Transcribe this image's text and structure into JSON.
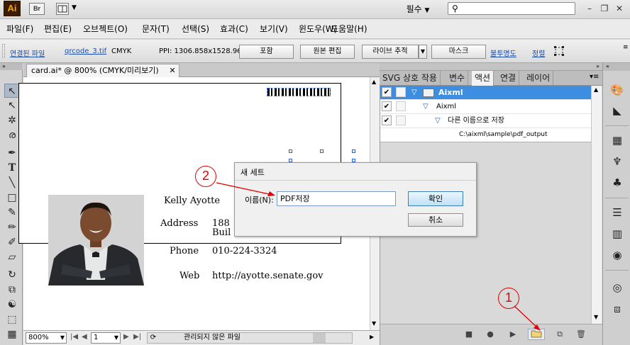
{
  "app": {
    "logo": "Ai",
    "bridge_label": "Br",
    "workspace": "필수",
    "search_placeholder": ""
  },
  "colors": {
    "accent_callout": "#e00000",
    "selection_blue": "#3d8ee0",
    "link_blue": "#1a4ea8"
  },
  "menu": [
    "파일(F)",
    "편집(E)",
    "오브젝트(O)",
    "문자(T)",
    "선택(S)",
    "효과(C)",
    "보기(V)",
    "윈도우(W)",
    "도움말(H)"
  ],
  "control": {
    "linked_file": "연결된 파일",
    "filename": "qrcode_3.tif",
    "colormode": "CMYK",
    "ppi": "PPI: 1306.858x1528.966",
    "embed": "포함",
    "edit_original": "원본 편집",
    "live_trace": "라이브 추적",
    "mask": "마스크",
    "opacity": "불투명도",
    "align": "정렬"
  },
  "document": {
    "tab_title": "card.ai* @ 800% (CMYK/미리보기)",
    "zoom": "800%",
    "page": "1",
    "status": "관리되지 않은 파일"
  },
  "card": {
    "name": "Kelly Ayotte",
    "address_label": "Address",
    "address_line1": "188",
    "address_line2": "Buil",
    "phone_label": "Phone",
    "phone": "010-224-3324",
    "web_label": "Web",
    "web": "http://ayotte.senate.gov"
  },
  "panel": {
    "tabs": [
      "SVG 상호 작용",
      "변수",
      "액션",
      "연결",
      "레이어"
    ],
    "active_tab": 2,
    "actions": [
      {
        "label": "Aixml",
        "level": 0,
        "checked": true,
        "selected": true,
        "type": "folder"
      },
      {
        "label": "Aixml",
        "level": 1,
        "checked": true,
        "selected": false,
        "type": "action"
      },
      {
        "label": "다른 이름으로 저장",
        "level": 2,
        "checked": true,
        "selected": false,
        "type": "command"
      },
      {
        "label": "C:\\aixml\\sample\\pdf_output",
        "level": 3,
        "checked": false,
        "selected": false,
        "type": "detail"
      }
    ]
  },
  "dialog": {
    "title": "새 세트",
    "name_label": "이름(N):",
    "name_value": "PDF저장",
    "ok": "확인",
    "cancel": "취소"
  },
  "callouts": [
    "1",
    "2"
  ]
}
